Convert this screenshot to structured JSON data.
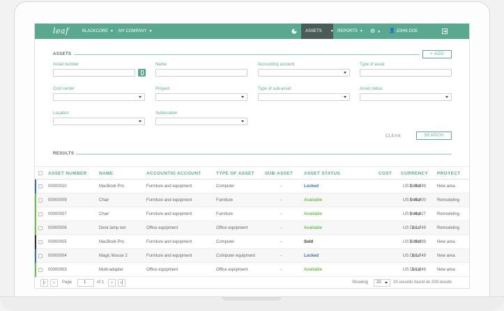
{
  "nav": {
    "logo": "leaf",
    "company1": "BLACKCORE",
    "company2": "MY COMPANY",
    "assets": "ASSETS",
    "reports": "REPORTS",
    "user": "JOHN DOE",
    "colors": {
      "nav": "#5aa88f",
      "active": "#4b5b57"
    }
  },
  "form": {
    "title": "Assets",
    "add_label": "+ ADD",
    "fields": {
      "asset_number": "Asset number",
      "name": "Name",
      "accounting_account": "Accounting account",
      "type_of_asset": "Type of asset",
      "cost_center": "Cost center",
      "proyect": "Proyect",
      "type_of_sub_asset": "Type of sub-asset",
      "asset_status": "Asset status",
      "location": "Location",
      "sublocation": "Sublocation"
    },
    "clean_label": "CLEAN",
    "search_label": "SEARCH"
  },
  "results": {
    "title": "Results",
    "headers": [
      "ASSET NUMBER",
      "NAME",
      "ACCOUNTIG ACCOUNT",
      "TYPE OF ASSET",
      "SUB-ASSET",
      "ASSET STATUS",
      "COST",
      "CURRENCY",
      "PROYECT"
    ],
    "rows": [
      {
        "number": "00000010",
        "name": "MacBook Pro",
        "account": "Furniture and equipment",
        "type": "Computer",
        "sub": "-",
        "status": "Locked",
        "cost": "$ 29,999",
        "currency": "US Dollar",
        "project": "New area",
        "bar_color": "#3a6fb0",
        "status_color": "#3a6fb0"
      },
      {
        "number": "00000009",
        "name": "Chair",
        "account": "Furniture and equipment",
        "type": "Furniture",
        "sub": "-",
        "status": "Available",
        "cost": "$ 46,000",
        "currency": "US Dollar",
        "project": "Remodeling",
        "bar_color": "#6cc04a",
        "status_color": "#6cc04a"
      },
      {
        "number": "00000007",
        "name": "Chair",
        "account": "Furniture and equipment",
        "type": "Furniture",
        "sub": "-",
        "status": "Available",
        "cost": "$ 46,827",
        "currency": "US Dollar",
        "project": "Remodeling",
        "bar_color": "#6cc04a",
        "status_color": "#6cc04a"
      },
      {
        "number": "00000006",
        "name": "Desk lamp led",
        "account": "Office equipment",
        "type": "Office equipment",
        "sub": "-",
        "status": "Available",
        "cost": "$ 1,749",
        "currency": "US Dollar",
        "project": "Remodeling",
        "bar_color": "#6cc04a",
        "status_color": "#6cc04a"
      },
      {
        "number": "00000005",
        "name": "MacBook Pro",
        "account": "Furniture and equipment",
        "type": "Computer",
        "sub": "-",
        "status": "Sold",
        "cost": "$ 29,999",
        "currency": "US Dollar",
        "project": "New area",
        "bar_color": "#333333",
        "status_color": "#333333"
      },
      {
        "number": "00000004",
        "name": "Magic Mouse 2",
        "account": "Furniture and equipment",
        "type": "Computer equipment",
        "sub": "-",
        "status": "Locked",
        "cost": "$ 1,749",
        "currency": "US Dollar",
        "project": "New area",
        "bar_color": "#3a6fb0",
        "status_color": "#3a6fb0"
      },
      {
        "number": "00000003",
        "name": "Multi-adapter",
        "account": "Office equipment",
        "type": "Office equipment",
        "sub": "-",
        "status": "Available",
        "cost": "$ 1,549",
        "currency": "US Dollar",
        "project": "New area",
        "bar_color": "#6cc04a",
        "status_color": "#6cc04a"
      }
    ]
  },
  "footer": {
    "page_label": "Page",
    "page_value": "1",
    "of_label": "of 1",
    "showing_label": "Showing",
    "per_page": "20",
    "summary": "20 records found on 200 results"
  }
}
